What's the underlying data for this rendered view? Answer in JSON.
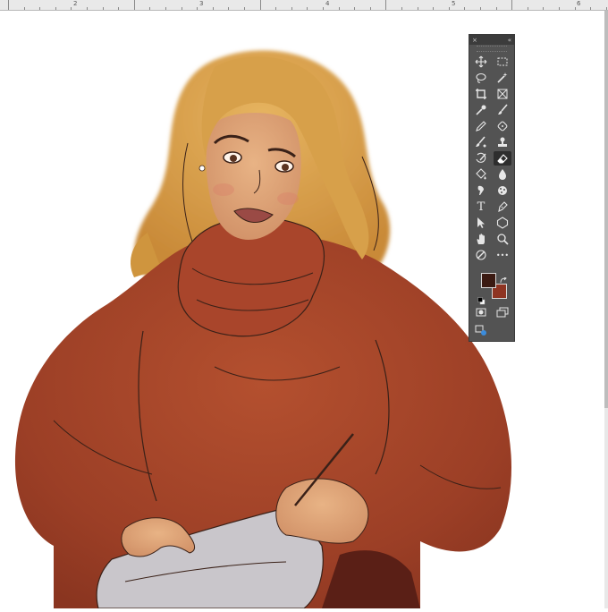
{
  "ruler": {
    "labels": [
      "2",
      "3",
      "4",
      "5",
      "6"
    ]
  },
  "toolbar": {
    "close_glyph": "×",
    "collapse_glyph": "«",
    "active_tool": "eraser-tool",
    "tools": [
      "move-tool",
      "marquee-tool",
      "lasso-tool",
      "magic-wand-tool",
      "crop-tool",
      "frame-tool",
      "eyedropper-tool",
      "brush-tool",
      "pencil-tool",
      "healing-brush-tool",
      "mixer-brush-tool",
      "clone-stamp-tool",
      "history-brush-tool",
      "eraser-tool",
      "paint-bucket-tool",
      "blur-tool",
      "smudge-tool",
      "sponge-tool",
      "type-tool",
      "pen-tool",
      "path-selection-tool",
      "ellipse-tool",
      "hand-tool",
      "zoom-tool",
      "rotate-view-tool",
      "more-tools"
    ],
    "type_glyph": "T",
    "more_glyph": "•••",
    "foreground_color": "#3b1a12",
    "background_color": "#8e3422"
  },
  "canvas": {
    "artwork": "illustrated-woman-red-sweater",
    "colors": {
      "hair": "#d9a347",
      "skin": "#e2a97c",
      "sweater": "#a8452a",
      "paper": "#c9c6cb",
      "line": "#3a2118"
    }
  }
}
